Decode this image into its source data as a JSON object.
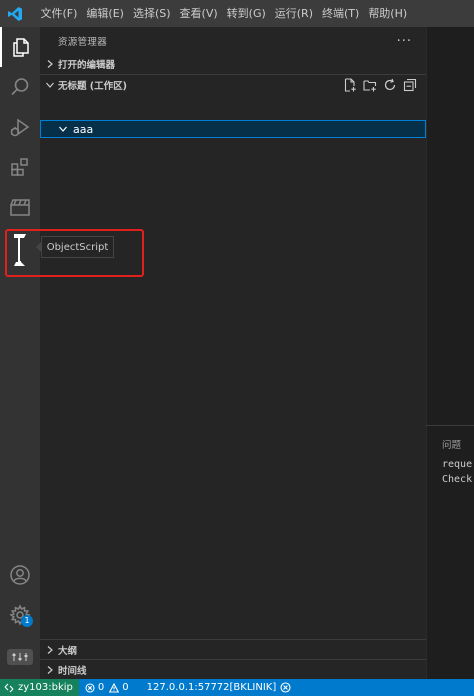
{
  "menu": [
    "文件(F)",
    "编辑(E)",
    "选择(S)",
    "查看(V)",
    "转到(G)",
    "运行(R)",
    "终端(T)",
    "帮助(H)"
  ],
  "activity": {
    "explorer_icon": "files-icon",
    "search_icon": "search-icon",
    "run_icon": "run-debug-icon",
    "extensions_icon": "extensions-icon",
    "media_icon": "clapperboard-icon",
    "objectscript_icon": "objectscript-icon",
    "accounts_icon": "account-icon",
    "settings_icon": "gear-icon",
    "settings_badge": "1",
    "sliders_icon": "sliders-icon"
  },
  "sidebar": {
    "title": "资源管理器",
    "more": "···",
    "open_editors": "打开的编辑器",
    "workspace": "无标题 (工作区)",
    "folder": "aaa",
    "outline": "大纲",
    "timeline": "时间线"
  },
  "tooltip": "ObjectScript",
  "panel": {
    "tab": "问题",
    "line1": "reque",
    "line2": "Check"
  },
  "status": {
    "remote": "zy103:bkip",
    "errors": "0",
    "warnings": "0",
    "server": "127.0.0.1:57772[BKLINIK]"
  },
  "colors": {
    "accent": "#007acc",
    "highlight": "#e0201c"
  }
}
